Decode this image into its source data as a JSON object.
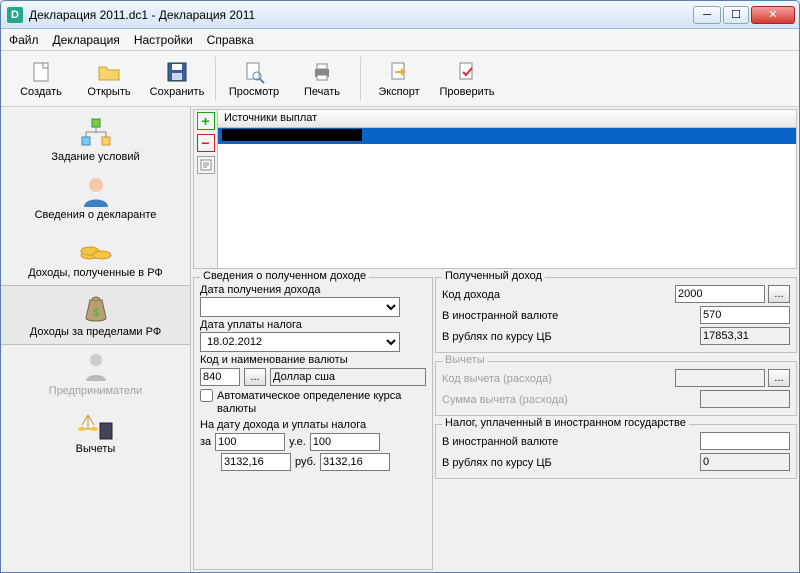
{
  "window": {
    "title": "Декларация 2011.dc1 - Декларация 2011"
  },
  "menu": {
    "file": "Файл",
    "decl": "Декларация",
    "settings": "Настройки",
    "help": "Справка"
  },
  "toolbar": {
    "create": "Создать",
    "open": "Открыть",
    "save": "Сохранить",
    "preview": "Просмотр",
    "print": "Печать",
    "export": "Экспорт",
    "check": "Проверить"
  },
  "sidebar": {
    "items": [
      {
        "label": "Задание условий"
      },
      {
        "label": "Сведения о декларанте"
      },
      {
        "label": "Доходы, полученные в РФ"
      },
      {
        "label": "Доходы за пределами РФ"
      },
      {
        "label": "Предприниматели"
      },
      {
        "label": "Вычеты"
      }
    ]
  },
  "sources": {
    "header": "Источники выплат"
  },
  "income_info": {
    "legend": "Сведения о полученном доходе",
    "date_received_label": "Дата получения дохода",
    "date_received": "",
    "date_tax_label": "Дата уплаты налога",
    "date_tax": "18.02.2012",
    "currency_label": "Код и наименование валюты",
    "currency_code": "840",
    "currency_name": "Доллар сша",
    "auto_rate": "Автоматическое определение курса валюты",
    "rate_subtitle": "На дату дохода и уплаты налога",
    "per_label": "за",
    "per_value": "100",
    "unit_label": "у.е.",
    "unit_value": "100",
    "rate1": "3132,16",
    "rub_label": "руб.",
    "rate2": "3132,16"
  },
  "received": {
    "legend": "Полученный доход",
    "code_label": "Код дохода",
    "code": "2000",
    "foreign_label": "В иностранной валюте",
    "foreign": "570",
    "rub_label": "В рублях по курсу ЦБ",
    "rub": "17853,31"
  },
  "deductions": {
    "legend": "Вычеты",
    "code_label": "Код вычета (расхода)",
    "sum_label": "Сумма вычета (расхода)"
  },
  "tax_paid": {
    "legend": "Налог, уплаченный в иностранном государстве",
    "foreign_label": "В иностранной валюте",
    "foreign": "",
    "rub_label": "В рублях по курсу ЦБ",
    "rub": "0"
  }
}
